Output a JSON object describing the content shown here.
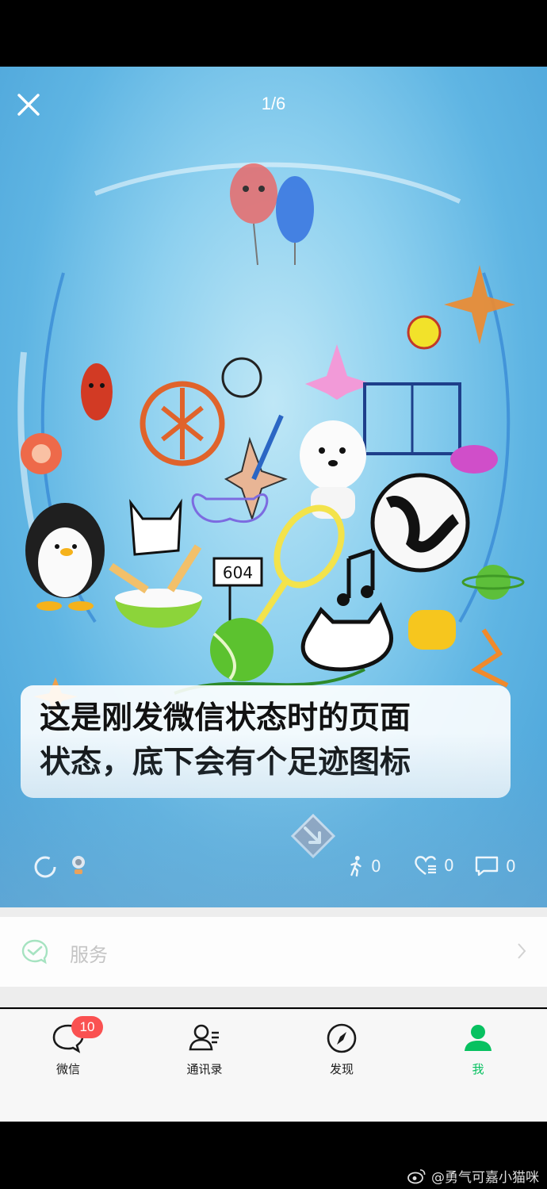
{
  "viewer": {
    "page_indicator": "1/6",
    "caption_line1": "这是刚发微信状态时的页面",
    "caption_line2": "状态，底下会有个足迹图标",
    "doodle_sign": "604",
    "actions": {
      "footprint_count": "0",
      "like_count": "0",
      "comment_count": "0"
    }
  },
  "services": {
    "label": "服务"
  },
  "tabbar": {
    "chats_label": "微信",
    "chats_badge": "10",
    "contacts_label": "通讯录",
    "discover_label": "发现",
    "me_label": "我",
    "active_color": "#07c160"
  },
  "watermark": {
    "text": "@勇气可嘉小猫咪",
    "icon": "weibo-icon"
  }
}
